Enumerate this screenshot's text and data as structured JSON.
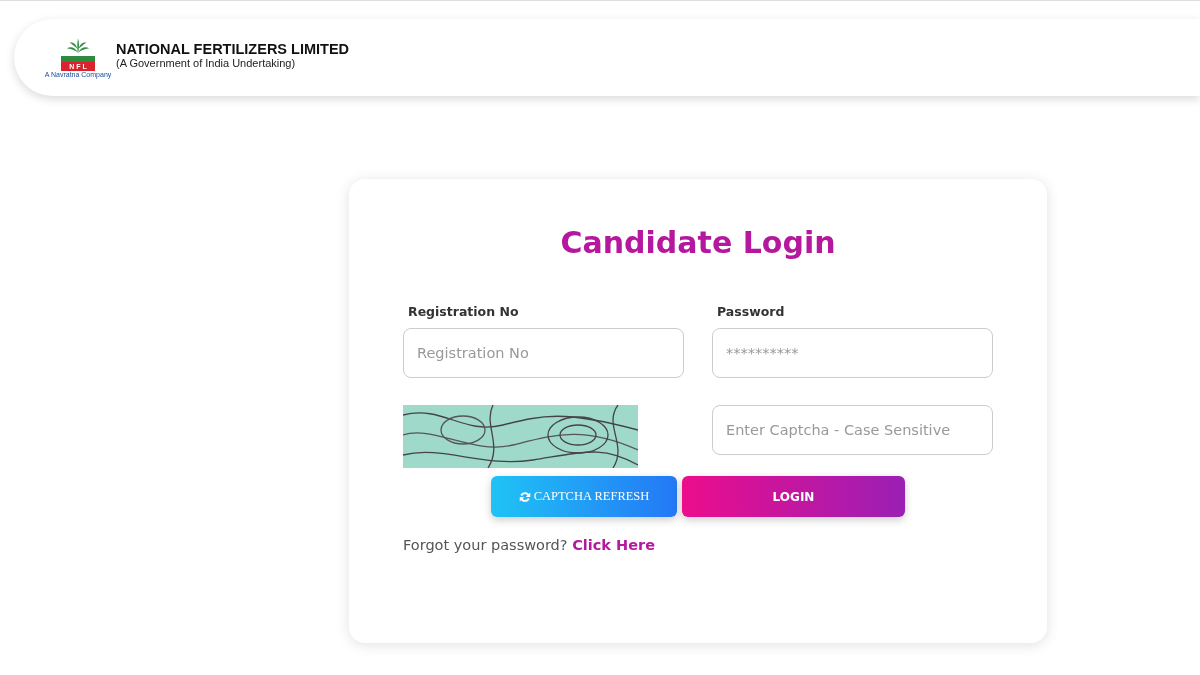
{
  "header": {
    "logo": {
      "letters": "N F L",
      "tagline": "A Navratna Company"
    },
    "company_name": "NATIONAL FERTILIZERS LIMITED",
    "subtitle": "(A Government of India Undertaking)"
  },
  "login": {
    "title": "Candidate Login",
    "fields": [
      {
        "label": "Registration No",
        "placeholder": "Registration No"
      },
      {
        "label": "Password",
        "placeholder": "**********"
      }
    ],
    "captcha": {
      "kind": "picture",
      "placeholder": "Enter Captcha - Case Sensitive"
    },
    "buttons": [
      {
        "kind": "refresh",
        "label": "CAPTCHA REFRESH"
      },
      {
        "kind": "submit",
        "label": "LOGIN"
      }
    ],
    "forgot": {
      "text": "Forgot your password?",
      "link": "Click Here"
    }
  }
}
